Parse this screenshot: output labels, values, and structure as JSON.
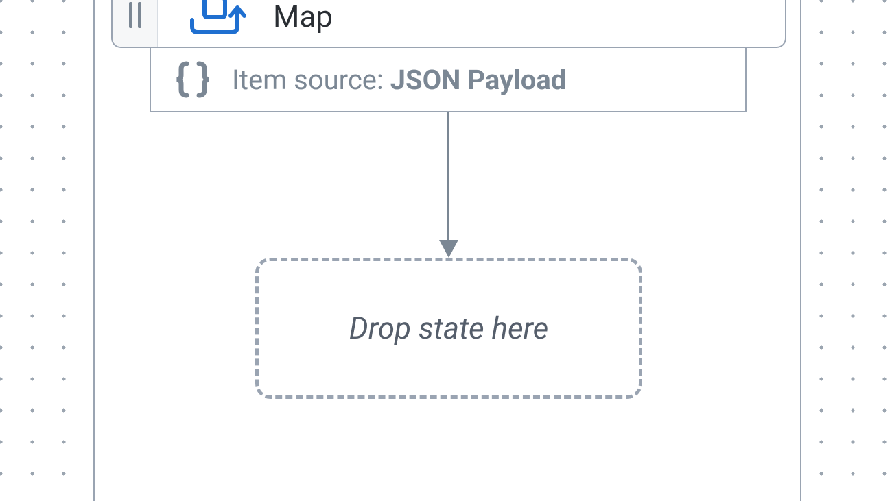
{
  "state": {
    "label": "Map"
  },
  "itemSource": {
    "label": "Item source:",
    "value": "JSON Payload"
  },
  "dropZone": {
    "placeholder": "Drop state here"
  },
  "icons": {
    "map": "map-loop-icon",
    "braces": "braces-icon",
    "drag": "drag-handle-icon"
  }
}
